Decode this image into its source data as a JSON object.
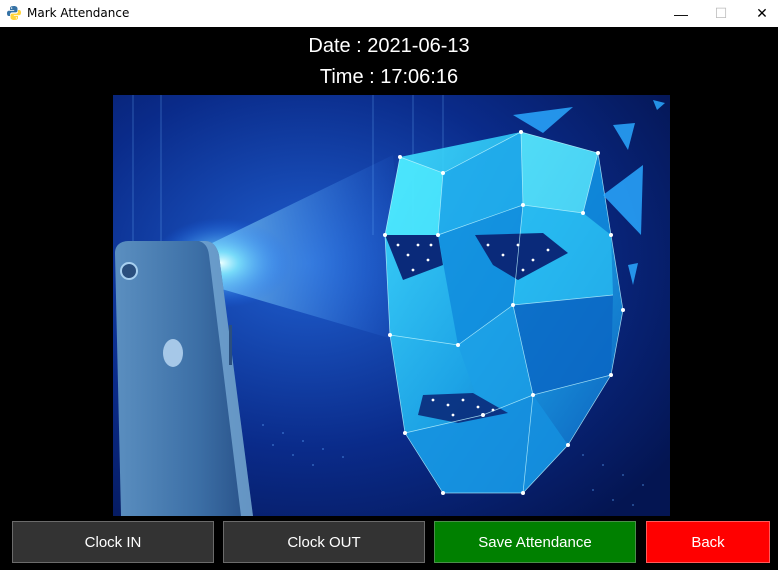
{
  "window": {
    "title": "Mark Attendance",
    "controls": {
      "minimize": "—",
      "maximize": "☐",
      "close": "✕"
    }
  },
  "header": {
    "date_text": "Date : 2021-06-13",
    "time_text": "Time : 17:06:16"
  },
  "buttons": {
    "clock_in": "Clock IN",
    "clock_out": "Clock OUT",
    "save": "Save Attendance",
    "back": "Back"
  },
  "colors": {
    "save_button": "#008000",
    "back_button": "#ff0000",
    "clock_buttons": "#333333"
  }
}
